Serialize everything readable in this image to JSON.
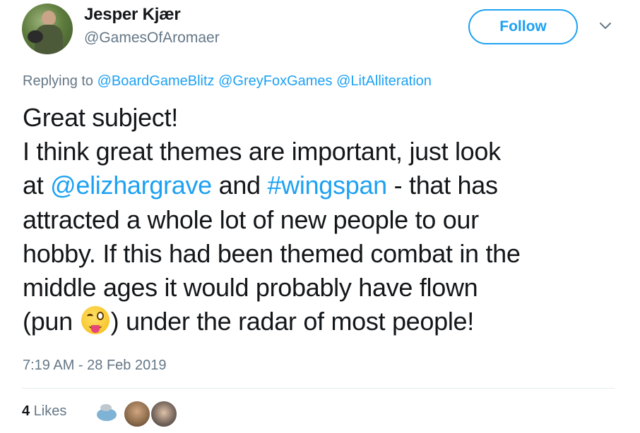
{
  "author": {
    "display_name": "Jesper Kjær",
    "handle": "@GamesOfAromaer",
    "avatar_icon": "profile-photo"
  },
  "follow_label": "Follow",
  "menu_icon": "chevron-down-icon",
  "replying": {
    "prefix": "Replying to",
    "mentions": [
      "@BoardGameBlitz",
      "@GreyFoxGames",
      "@LitAlliteration"
    ]
  },
  "tweet": {
    "line1": "Great subject!",
    "line2": "I think great themes are important, just look",
    "seg_at": "at ",
    "mention": "@elizhargrave",
    "seg_and": " and ",
    "hashtag": "#wingspan",
    "seg_after_hashtag": " - that has",
    "line4": "attracted a whole lot of new people to our",
    "line5": "hobby. If this had been themed combat in the",
    "line6": "middle ages it would probably have flown",
    "seg_pun": "(pun ",
    "emoji": "winking-face-with-tongue",
    "seg_end": ") under the radar of most people!"
  },
  "timestamp": "7:19 AM - 28 Feb 2019",
  "likes": {
    "count": "4",
    "label": " Likes",
    "avatars": [
      "liker-avatar-1",
      "liker-avatar-2",
      "liker-avatar-3"
    ]
  },
  "colors": {
    "link": "#1da1f2",
    "secondary_text": "#657786",
    "primary_text": "#14171a",
    "divider": "#e6ecf0"
  }
}
